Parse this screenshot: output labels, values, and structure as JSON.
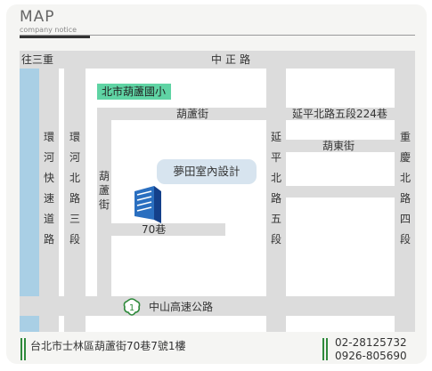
{
  "header": {
    "title": "MAP",
    "subtitle": "company notice"
  },
  "map": {
    "roads_h": {
      "top": "往三重",
      "top_center": "中正路",
      "hulu_st": "葫蘆街",
      "yanping": "延平北路五段224巷",
      "hudong": "葫東街",
      "alley70": "70巷",
      "freeway": "中山高速公路"
    },
    "roads_v": {
      "huanhe_express": [
        "環",
        "河",
        "快",
        "速",
        "道",
        "路"
      ],
      "huanhe_north": [
        "環",
        "河",
        "北",
        "路",
        "三",
        "段"
      ],
      "hulu_v": [
        "葫",
        "蘆",
        "街"
      ],
      "yanping_5": [
        "延",
        "平",
        "北",
        "路",
        "五",
        "段"
      ],
      "chongqing_4": [
        "重",
        "慶",
        "北",
        "路",
        "四",
        "段"
      ]
    },
    "landmark_school": "北市葫蘆國小",
    "destination": "夢田室內設計",
    "freeway_shield": "1"
  },
  "footer": {
    "address": "台北市士林區葫蘆街70巷7號1樓",
    "phones": [
      "02-28125732",
      "0926-805690"
    ]
  },
  "colors": {
    "river": "#a9cfe5",
    "road": "#dcdcdc",
    "school": "#5fd4a4",
    "accent_bar": "#2f8a3c",
    "building": "#2a6fc0"
  }
}
